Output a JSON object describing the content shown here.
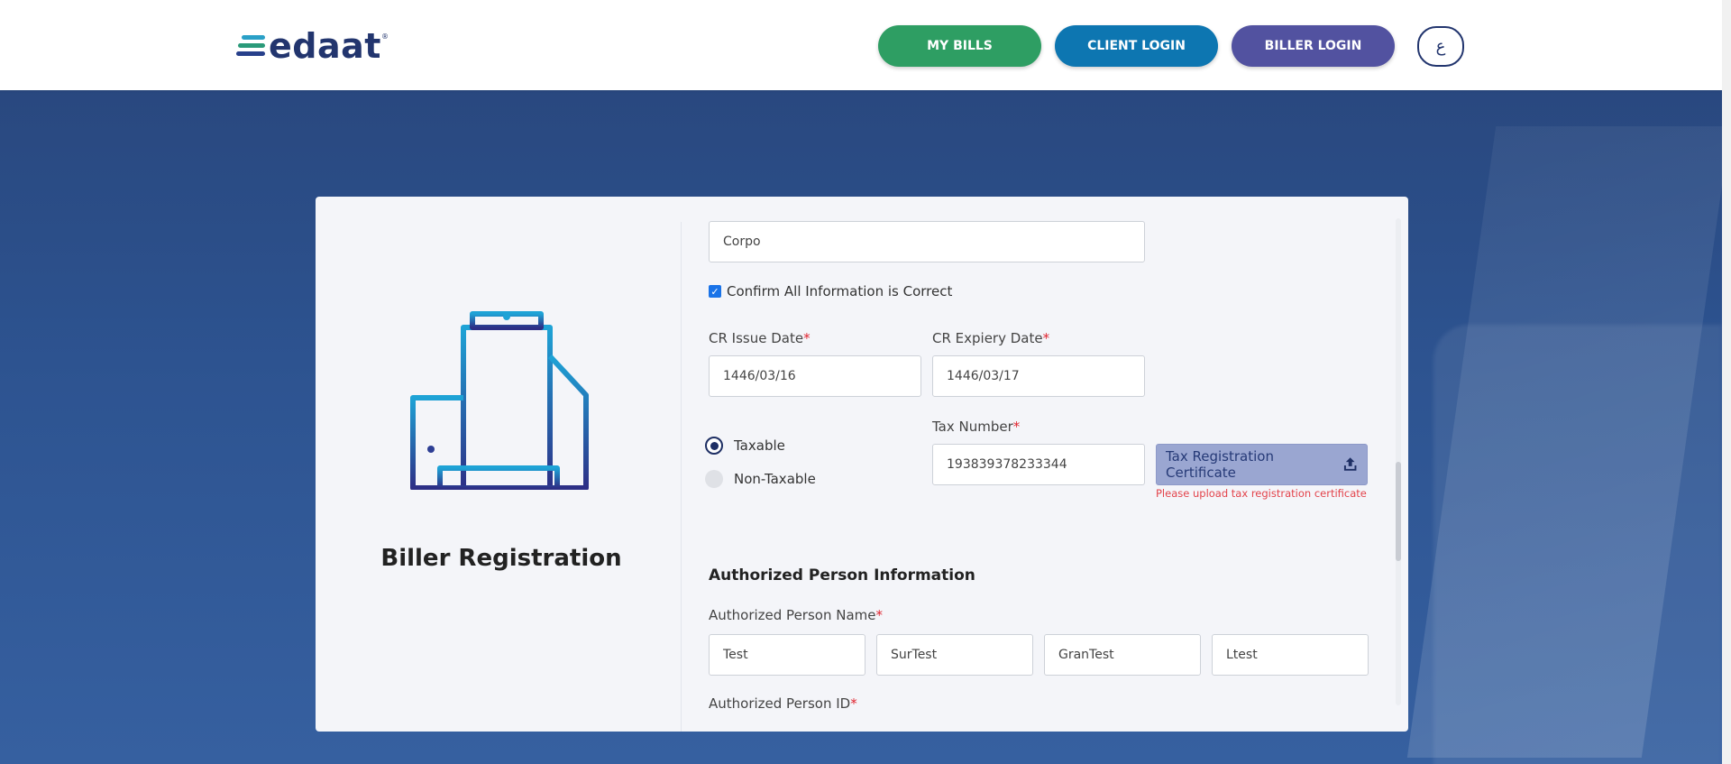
{
  "header": {
    "logo_text": "edaat",
    "logo_tm": "®",
    "buttons": {
      "my_bills": "MY BILLS",
      "client_login": "CLIENT LOGIN",
      "biller_login": "BILLER LOGIN",
      "language": "ع"
    }
  },
  "sidebar": {
    "title": "Biller Registration"
  },
  "form": {
    "company_type_value": "Corpo",
    "confirm_label": "Confirm All Information is Correct",
    "confirm_checked": true,
    "cr_issue_date": {
      "label": "CR Issue Date",
      "required": "*",
      "value": "1446/03/16"
    },
    "cr_expiry_date": {
      "label": "CR Expiery Date",
      "required": "*",
      "value": "1446/03/17"
    },
    "tax_status": {
      "options": [
        "Taxable",
        "Non-Taxable"
      ],
      "selected": "Taxable"
    },
    "tax_number": {
      "label": "Tax Number",
      "required": "*",
      "value": "193839378233344"
    },
    "tax_certificate_button": "Tax Registration Certificate",
    "tax_certificate_error": "Please upload tax registration certificate",
    "authorized_section_title": "Authorized Person Information",
    "authorized_name": {
      "label": "Authorized Person Name",
      "required": "*",
      "values": [
        "Test",
        "SurTest",
        "GranTest",
        "Ltest"
      ]
    },
    "authorized_id": {
      "label": "Authorized Person ID",
      "required": "*"
    }
  },
  "colors": {
    "my_bills": "#2e9e63",
    "client_login": "#0d76b1",
    "biller_login": "#5252a0",
    "brand_navy": "#22356e",
    "error": "#e3434b"
  }
}
